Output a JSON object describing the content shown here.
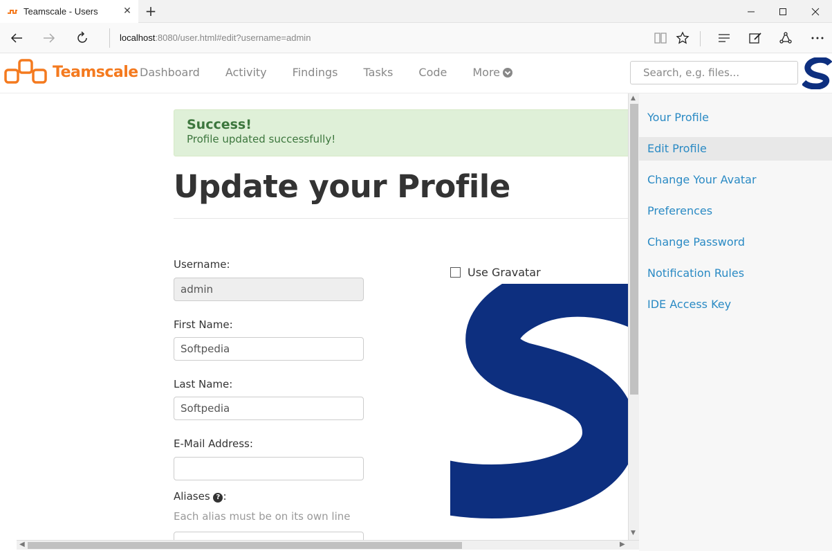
{
  "browser": {
    "tab_title": "Teamscale - Users",
    "address_host": "localhost",
    "address_rest": ":8080/user.html#edit?username=admin"
  },
  "header": {
    "logo_text": "Teamscale",
    "nav": [
      "Dashboard",
      "Activity",
      "Findings",
      "Tasks",
      "Code",
      "More"
    ],
    "search_placeholder": "Search, e.g. files..."
  },
  "alert": {
    "title": "Success!",
    "message": "Profile updated successfully!"
  },
  "page_title": "Update your Profile",
  "form": {
    "username_label": "Username:",
    "username_value": "admin",
    "first_name_label": "First Name:",
    "first_name_value": "Softpedia",
    "last_name_label": "Last Name:",
    "last_name_value": "Softpedia",
    "email_label": "E-Mail Address:",
    "email_value": "",
    "aliases_label": "Aliases",
    "aliases_suffix": ":",
    "aliases_help": "Each alias must be on its own line",
    "use_gravatar_label": "Use Gravatar",
    "use_gravatar_checked": false
  },
  "sidebar": {
    "items": [
      {
        "label": "Your Profile",
        "active": false
      },
      {
        "label": "Edit Profile",
        "active": true
      },
      {
        "label": "Change Your Avatar",
        "active": false
      },
      {
        "label": "Preferences",
        "active": false
      },
      {
        "label": "Change Password",
        "active": false
      },
      {
        "label": "Notification Rules",
        "active": false
      },
      {
        "label": "IDE Access Key",
        "active": false
      }
    ]
  },
  "colors": {
    "brand_orange": "#f47a1f",
    "link_blue": "#2a8ac4",
    "success_bg": "#dff0d8",
    "success_text": "#3c763d",
    "avatar_navy": "#0d2f7f"
  }
}
